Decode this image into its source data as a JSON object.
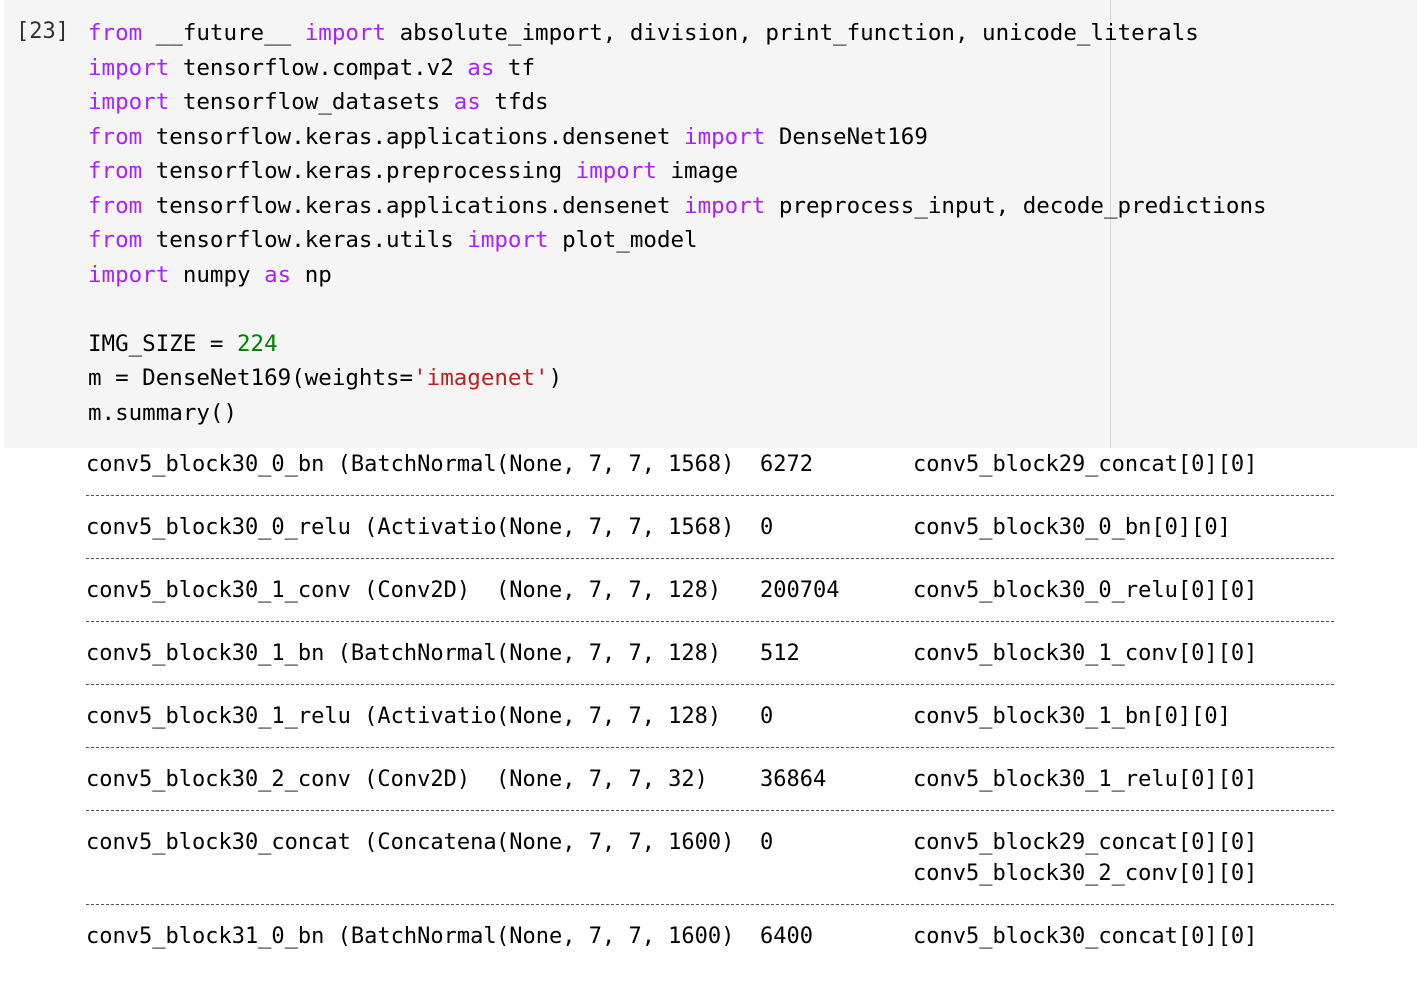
{
  "cell": {
    "prompt": "[23]",
    "code_lines": [
      [
        {
          "t": "from",
          "k": "kw"
        },
        {
          "t": " __future__ "
        },
        {
          "t": "import",
          "k": "kw"
        },
        {
          "t": " absolute_import, division, print_function, unicode_literals"
        }
      ],
      [
        {
          "t": "import",
          "k": "kw"
        },
        {
          "t": " tensorflow.compat.v2 "
        },
        {
          "t": "as",
          "k": "kw"
        },
        {
          "t": " tf"
        }
      ],
      [
        {
          "t": "import",
          "k": "kw"
        },
        {
          "t": " tensorflow_datasets "
        },
        {
          "t": "as",
          "k": "kw"
        },
        {
          "t": " tfds"
        }
      ],
      [
        {
          "t": "from",
          "k": "kw"
        },
        {
          "t": " tensorflow.keras.applications.densenet "
        },
        {
          "t": "import",
          "k": "kw"
        },
        {
          "t": " DenseNet169"
        }
      ],
      [
        {
          "t": "from",
          "k": "kw"
        },
        {
          "t": " tensorflow.keras.preprocessing "
        },
        {
          "t": "import",
          "k": "kw"
        },
        {
          "t": " image"
        }
      ],
      [
        {
          "t": "from",
          "k": "kw"
        },
        {
          "t": " tensorflow.keras.applications.densenet "
        },
        {
          "t": "import",
          "k": "kw"
        },
        {
          "t": " preprocess_input, decode_predictions"
        }
      ],
      [
        {
          "t": "from",
          "k": "kw"
        },
        {
          "t": " tensorflow.keras.utils "
        },
        {
          "t": "import",
          "k": "kw"
        },
        {
          "t": " plot_model"
        }
      ],
      [
        {
          "t": "import",
          "k": "kw"
        },
        {
          "t": " numpy "
        },
        {
          "t": "as",
          "k": "kw"
        },
        {
          "t": " np"
        }
      ],
      [],
      [
        {
          "t": "IMG_SIZE = "
        },
        {
          "t": "224",
          "k": "num"
        }
      ],
      [
        {
          "t": "m = DenseNet169(weights="
        },
        {
          "t": "'imagenet'",
          "k": "str"
        },
        {
          "t": ")"
        }
      ],
      [
        {
          "t": "m.summary()"
        }
      ]
    ]
  },
  "output": {
    "rows": [
      {
        "name": "conv5_block30_0_bn (BatchNormal",
        "shape": "(None, 7, 7, 1568)",
        "params": "6272",
        "connected": [
          "conv5_block29_concat[0][0]"
        ]
      },
      {
        "name": "conv5_block30_0_relu (Activatio",
        "shape": "(None, 7, 7, 1568)",
        "params": "0",
        "connected": [
          "conv5_block30_0_bn[0][0]"
        ]
      },
      {
        "name": "conv5_block30_1_conv (Conv2D)",
        "shape": "(None, 7, 7, 128)",
        "params": "200704",
        "connected": [
          "conv5_block30_0_relu[0][0]"
        ]
      },
      {
        "name": "conv5_block30_1_bn (BatchNormal",
        "shape": "(None, 7, 7, 128)",
        "params": "512",
        "connected": [
          "conv5_block30_1_conv[0][0]"
        ]
      },
      {
        "name": "conv5_block30_1_relu (Activatio",
        "shape": "(None, 7, 7, 128)",
        "params": "0",
        "connected": [
          "conv5_block30_1_bn[0][0]"
        ]
      },
      {
        "name": "conv5_block30_2_conv (Conv2D)",
        "shape": "(None, 7, 7, 32)",
        "params": "36864",
        "connected": [
          "conv5_block30_1_relu[0][0]"
        ]
      },
      {
        "name": "conv5_block30_concat (Concatena",
        "shape": "(None, 7, 7, 1600)",
        "params": "0",
        "connected": [
          "conv5_block29_concat[0][0]",
          "conv5_block30_2_conv[0][0]"
        ]
      },
      {
        "name": "conv5_block31_0_bn (BatchNormal",
        "shape": "(None, 7, 7, 1600)",
        "params": "6400",
        "connected": [
          "conv5_block30_concat[0][0]"
        ]
      }
    ]
  },
  "colors": {
    "keyword": "#aa22ff",
    "number": "#008000",
    "string": "#ba2121",
    "cell_background": "#f5f5f5"
  }
}
